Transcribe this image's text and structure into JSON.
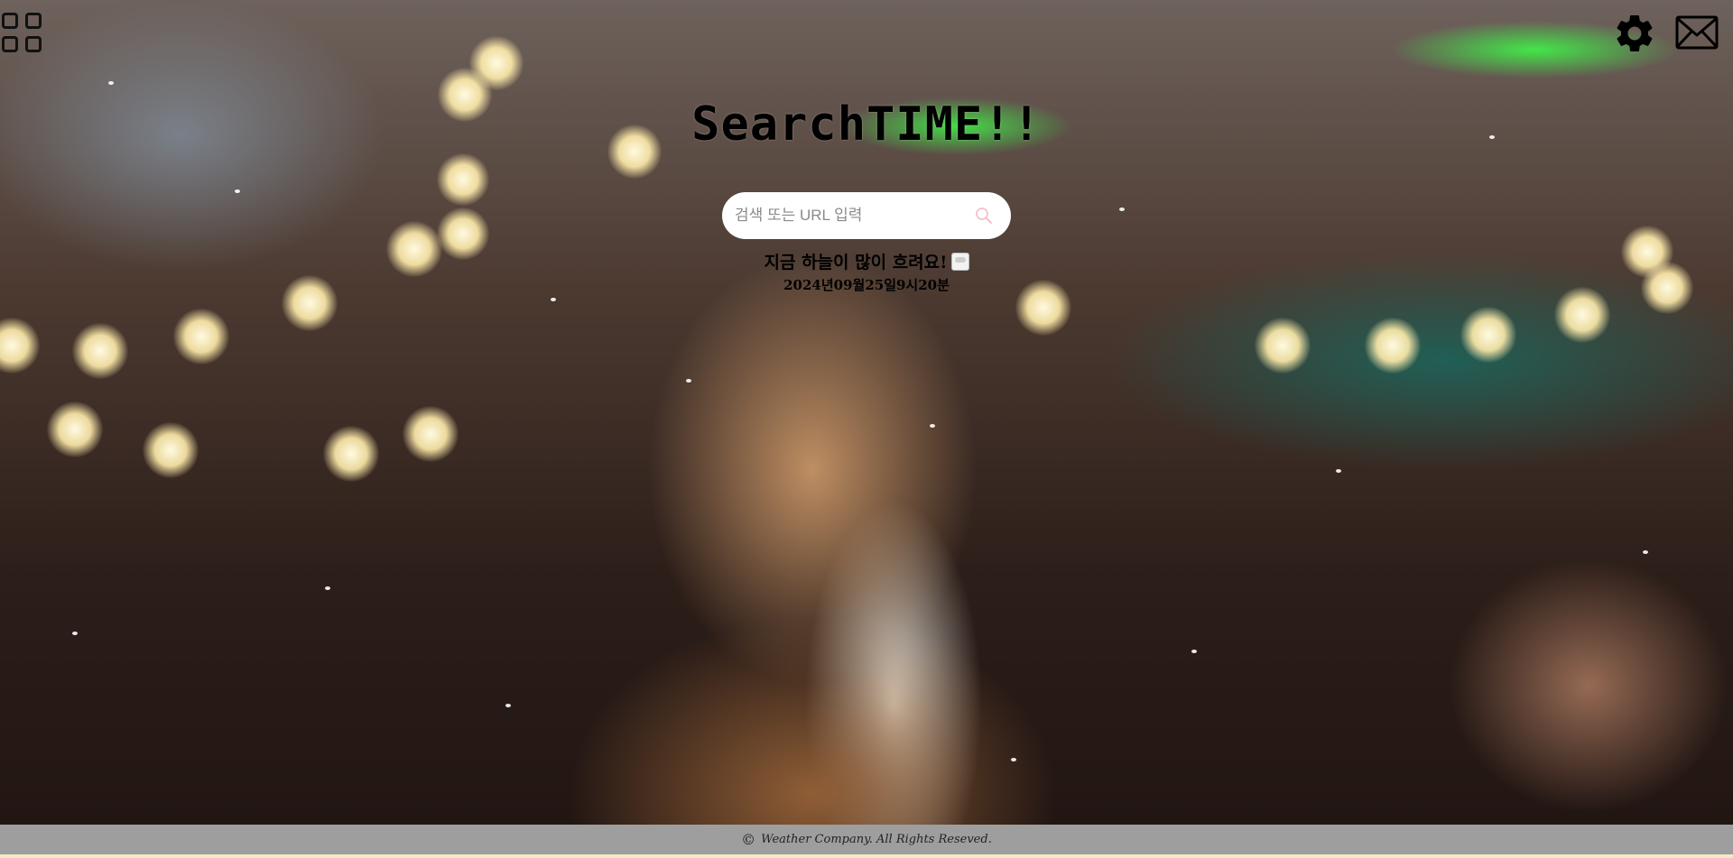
{
  "app": {
    "title": "SearchTIME!!"
  },
  "search": {
    "placeholder": "검색 또는 URL 입력",
    "value": ""
  },
  "weather": {
    "message": "지금 하늘이 많이 흐려요!",
    "icon": "cloud-icon",
    "datetime": "2024년09월25일9시20분"
  },
  "header": {
    "apps_icon": "apps-grid-icon",
    "settings_icon": "gear-icon",
    "mail_icon": "mail-icon"
  },
  "footer": {
    "copyright_symbol": "©",
    "text": "Weather Company. All Rights Reseved."
  },
  "colors": {
    "footer_bg": "#9e9e9e",
    "search_bg": "#ffffff",
    "search_icon": "#f4c2c8",
    "title_text": "#000000"
  }
}
